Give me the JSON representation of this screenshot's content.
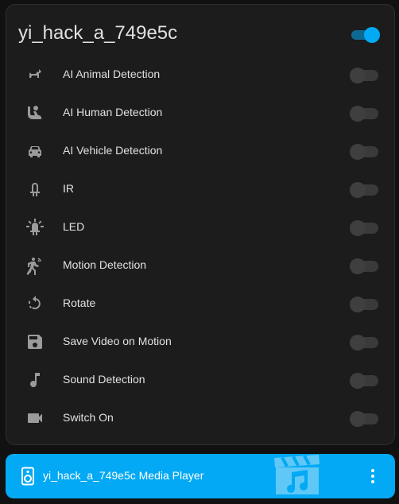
{
  "card": {
    "title": "yi_hack_a_749e5c",
    "master_toggle_on": true,
    "accent": "#03a9f4"
  },
  "rows": [
    {
      "label": "AI Animal Detection",
      "icon": "dog-icon",
      "on": false
    },
    {
      "label": "AI Human Detection",
      "icon": "human-icon",
      "on": false
    },
    {
      "label": "AI Vehicle Detection",
      "icon": "car-icon",
      "on": false
    },
    {
      "label": "IR",
      "icon": "ir-led-icon",
      "on": false
    },
    {
      "label": "LED",
      "icon": "led-on-icon",
      "on": false
    },
    {
      "label": "Motion Detection",
      "icon": "motion-sensor-icon",
      "on": false
    },
    {
      "label": "Rotate",
      "icon": "rotate-icon",
      "on": false
    },
    {
      "label": "Save Video on Motion",
      "icon": "floppy-icon",
      "on": false
    },
    {
      "label": "Sound Detection",
      "icon": "music-note-icon",
      "on": false
    },
    {
      "label": "Switch On",
      "icon": "video-camera-icon",
      "on": false
    }
  ],
  "media_player": {
    "title": "yi_hack_a_749e5c Media Player",
    "icon": "speaker-icon",
    "menu_icon": "dots-vertical-icon",
    "art_icon": "music-clapperboard-icon",
    "background": "#03a9f4"
  }
}
